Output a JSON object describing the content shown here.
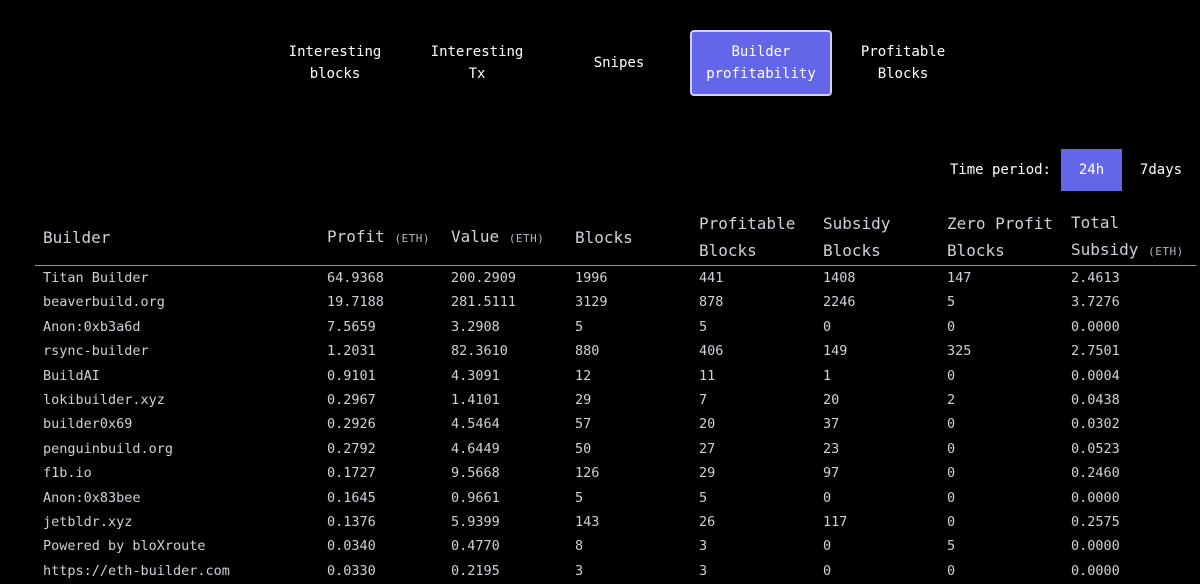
{
  "nav": {
    "tabs": [
      {
        "label": "Interesting blocks"
      },
      {
        "label": "Interesting Tx"
      },
      {
        "label": "Snipes"
      },
      {
        "label": "Builder profitability"
      },
      {
        "label": "Profitable Blocks"
      }
    ],
    "active_tab": "Builder profitability"
  },
  "period": {
    "label": "Time period:",
    "options": [
      "24h",
      "7days"
    ],
    "selected": "24h"
  },
  "table": {
    "headers": [
      {
        "label": "Builder",
        "unit": ""
      },
      {
        "label": "Profit",
        "unit": "(ETH)"
      },
      {
        "label": "Value",
        "unit": "(ETH)"
      },
      {
        "label": "Blocks",
        "unit": ""
      },
      {
        "label": "Profitable Blocks",
        "unit": ""
      },
      {
        "label": "Subsidy Blocks",
        "unit": ""
      },
      {
        "label": "Zero Profit Blocks",
        "unit": ""
      },
      {
        "label": "Total Subsidy",
        "unit": "(ETH)"
      }
    ],
    "rows": [
      [
        "Titan Builder",
        "64.9368",
        "200.2909",
        "1996",
        "441",
        "1408",
        "147",
        "2.4613"
      ],
      [
        "beaverbuild.org",
        "19.7188",
        "281.5111",
        "3129",
        "878",
        "2246",
        "5",
        "3.7276"
      ],
      [
        "Anon:0xb3a6d",
        "7.5659",
        "3.2908",
        "5",
        "5",
        "0",
        "0",
        "0.0000"
      ],
      [
        "rsync-builder",
        "1.2031",
        "82.3610",
        "880",
        "406",
        "149",
        "325",
        "2.7501"
      ],
      [
        "BuildAI",
        "0.9101",
        "4.3091",
        "12",
        "11",
        "1",
        "0",
        "0.0004"
      ],
      [
        "lokibuilder.xyz",
        "0.2967",
        "1.4101",
        "29",
        "7",
        "20",
        "2",
        "0.0438"
      ],
      [
        "builder0x69",
        "0.2926",
        "4.5464",
        "57",
        "20",
        "37",
        "0",
        "0.0302"
      ],
      [
        "penguinbuild.org",
        "0.2792",
        "4.6449",
        "50",
        "27",
        "23",
        "0",
        "0.0523"
      ],
      [
        "f1b.io",
        "0.1727",
        "9.5668",
        "126",
        "29",
        "97",
        "0",
        "0.2460"
      ],
      [
        "Anon:0x83bee",
        "0.1645",
        "0.9661",
        "5",
        "5",
        "0",
        "0",
        "0.0000"
      ],
      [
        "jetbldr.xyz",
        "0.1376",
        "5.9399",
        "143",
        "26",
        "117",
        "0",
        "0.2575"
      ],
      [
        "Powered by bloXroute",
        "0.0340",
        "0.4770",
        "8",
        "3",
        "0",
        "5",
        "0.0000"
      ],
      [
        "https://eth-builder.com",
        "0.0330",
        "0.2195",
        "3",
        "3",
        "0",
        "0",
        "0.0000"
      ]
    ]
  },
  "colors": {
    "background": "#000000",
    "accent": "#6366e8",
    "active_border": "#cfd0ff",
    "text": "#d0d0d8"
  }
}
